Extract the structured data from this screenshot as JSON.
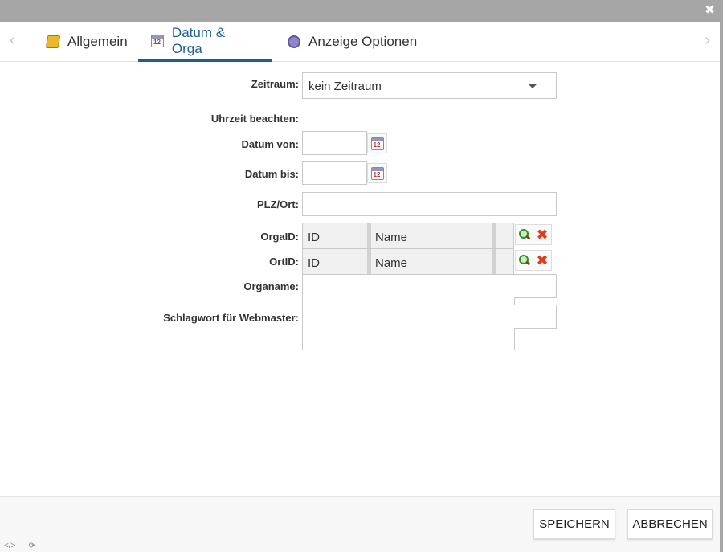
{
  "window": {
    "close_glyph": "✖"
  },
  "tabs": [
    {
      "label": "Allgemein",
      "icon": "folder-icon",
      "active": false
    },
    {
      "label": "Datum & Orga",
      "icon": "calendar-icon",
      "active": true
    },
    {
      "label": "Anzeige Optionen",
      "icon": "gear-icon",
      "active": false
    }
  ],
  "nav": {
    "prev": "‹",
    "next": "›"
  },
  "form": {
    "zeitraum": {
      "label": "Zeitraum:",
      "value": "kein Zeitraum"
    },
    "uhrzeit": {
      "label": "Uhrzeit beachten:"
    },
    "datum_von": {
      "label": "Datum von:",
      "value": ""
    },
    "datum_bis": {
      "label": "Datum bis:",
      "value": ""
    },
    "plz_ort": {
      "label": "PLZ/Ort:",
      "value": ""
    },
    "orga_id": {
      "label": "OrgaID:",
      "col_id": "ID",
      "col_name": "Name"
    },
    "ort_id": {
      "label": "OrtID:",
      "col_id": "ID",
      "col_name": "Name"
    },
    "organame": {
      "label": "Organame:",
      "value": ""
    },
    "schlagwort": {
      "label": "Schlagwort für Webmaster:",
      "value": ""
    }
  },
  "footer": {
    "save_label": "SPEICHERN",
    "cancel_label": "ABBRECHEN"
  },
  "bottom_icons": [
    "code-icon",
    "refresh-icon"
  ],
  "colors": {
    "accent": "#1c5f95",
    "titlebar": "#a6a6a6",
    "delete": "#e03b1f"
  }
}
